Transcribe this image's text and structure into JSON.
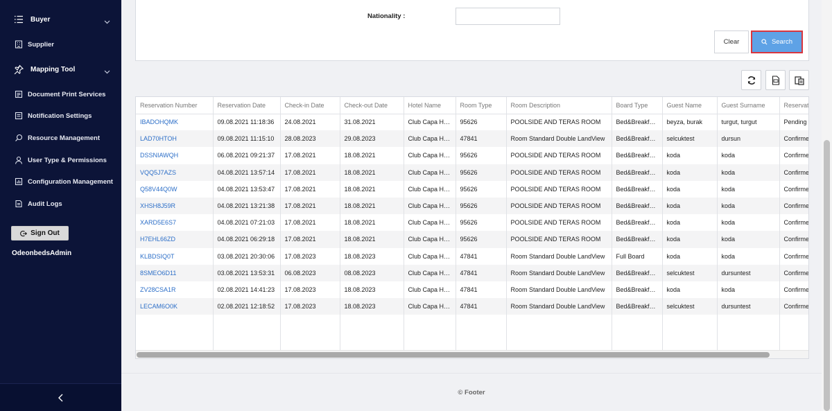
{
  "sidebar": {
    "items": [
      {
        "label": "Buyer",
        "icon": "list-icon",
        "major": true,
        "chevron": true
      },
      {
        "label": "Supplier",
        "icon": "building-icon"
      },
      {
        "label": "Mapping Tool",
        "icon": "pin-icon",
        "major": true,
        "chevron": true
      },
      {
        "label": "Document Print Services",
        "icon": "document-icon"
      },
      {
        "label": "Notification Settings",
        "icon": "notification-icon"
      },
      {
        "label": "Resource Management",
        "icon": "search-icon"
      },
      {
        "label": "User Type & Permissions",
        "icon": "user-icon"
      },
      {
        "label": "Configuration Management",
        "icon": "chart-icon"
      },
      {
        "label": "Audit Logs",
        "icon": "log-icon"
      }
    ],
    "signout_label": "Sign Out",
    "username": "OdeonbedsAdmin"
  },
  "filter": {
    "nationality_label": "Nationality :",
    "nationality_value": "",
    "clear_label": "Clear",
    "search_label": "Search"
  },
  "table": {
    "columns": [
      "Reservation Number",
      "Reservation Date",
      "Check-in Date",
      "Check-out Date",
      "Hotel Name",
      "Room Type",
      "Room Description",
      "Board Type",
      "Guest Name",
      "Guest Surname",
      "Reservation Status"
    ],
    "rows": [
      [
        "IBADOHQMK",
        "09.08.2021 11:18:36",
        "24.08.2021",
        "31.08.2021",
        "Club Capa Hotel",
        "95626",
        "POOLSIDE AND TERAS ROOM",
        "Bed&Breakfast",
        "beyza, burak",
        "turgut, turgut",
        "Pending"
      ],
      [
        "LAD70HTOH",
        "09.08.2021 11:15:10",
        "28.08.2023",
        "29.08.2023",
        "Club Capa Hotel",
        "47841",
        "Room Standard Double LandView",
        "Bed&Breakfast",
        "selcuktest",
        "dursun",
        "Confirmed"
      ],
      [
        "DSSNIAWQH",
        "06.08.2021 09:21:37",
        "17.08.2021",
        "18.08.2021",
        "Club Capa Hotel",
        "95626",
        "POOLSIDE AND TERAS ROOM",
        "Bed&Breakfast",
        "koda",
        "koda",
        "Confirmed"
      ],
      [
        "VQQ5J7AZS",
        "04.08.2021 13:57:14",
        "17.08.2021",
        "18.08.2021",
        "Club Capa Hotel",
        "95626",
        "POOLSIDE AND TERAS ROOM",
        "Bed&Breakfast",
        "koda",
        "koda",
        "Confirmed"
      ],
      [
        "Q58V44Q0W",
        "04.08.2021 13:53:47",
        "17.08.2021",
        "18.08.2021",
        "Club Capa Hotel",
        "95626",
        "POOLSIDE AND TERAS ROOM",
        "Bed&Breakfast",
        "koda",
        "koda",
        "Confirmed"
      ],
      [
        "XHSH8J59R",
        "04.08.2021 13:21:38",
        "17.08.2021",
        "18.08.2021",
        "Club Capa Hotel",
        "95626",
        "POOLSIDE AND TERAS ROOM",
        "Bed&Breakfast",
        "koda",
        "koda",
        "Confirmed"
      ],
      [
        "XARD5E6S7",
        "04.08.2021 07:21:03",
        "17.08.2021",
        "18.08.2021",
        "Club Capa Hotel",
        "95626",
        "POOLSIDE AND TERAS ROOM",
        "Bed&Breakfast",
        "koda",
        "koda",
        "Confirmed"
      ],
      [
        "H7EHL66ZD",
        "04.08.2021 06:29:18",
        "17.08.2021",
        "18.08.2021",
        "Club Capa Hotel",
        "95626",
        "POOLSIDE AND TERAS ROOM",
        "Bed&Breakfast",
        "koda",
        "koda",
        "Confirmed"
      ],
      [
        "KLBDSIQ0T",
        "03.08.2021 20:30:06",
        "17.08.2023",
        "18.08.2023",
        "Club Capa Hotel",
        "47841",
        "Room Standard Double LandView",
        "Full Board",
        "koda",
        "koda",
        "Confirmed"
      ],
      [
        "8SMEO6D11",
        "03.08.2021 13:53:31",
        "06.08.2023",
        "08.08.2023",
        "Club Capa Hotel",
        "47841",
        "Room Standard Double LandView",
        "Bed&Breakfast",
        "selcuktest",
        "dursuntest",
        "Confirmed"
      ],
      [
        "ZV28CSA1R",
        "02.08.2021 14:41:23",
        "17.08.2023",
        "18.08.2023",
        "Club Capa Hotel",
        "47841",
        "Room Standard Double LandView",
        "Bed&Breakfast",
        "koda",
        "koda",
        "Confirmed"
      ],
      [
        "LECAM6O0K",
        "02.08.2021 12:18:52",
        "17.08.2023",
        "18.08.2023",
        "Club Capa Hotel",
        "47841",
        "Room Standard Double LandView",
        "Bed&Breakfast",
        "selcuktest",
        "dursuntest",
        "Confirmed"
      ]
    ]
  },
  "footer": {
    "text": "© Footer"
  },
  "colors": {
    "sidebar": "#0c1438",
    "link": "#2d6fc8",
    "search_button": "#5ea2e6",
    "search_border": "#d9363e"
  }
}
